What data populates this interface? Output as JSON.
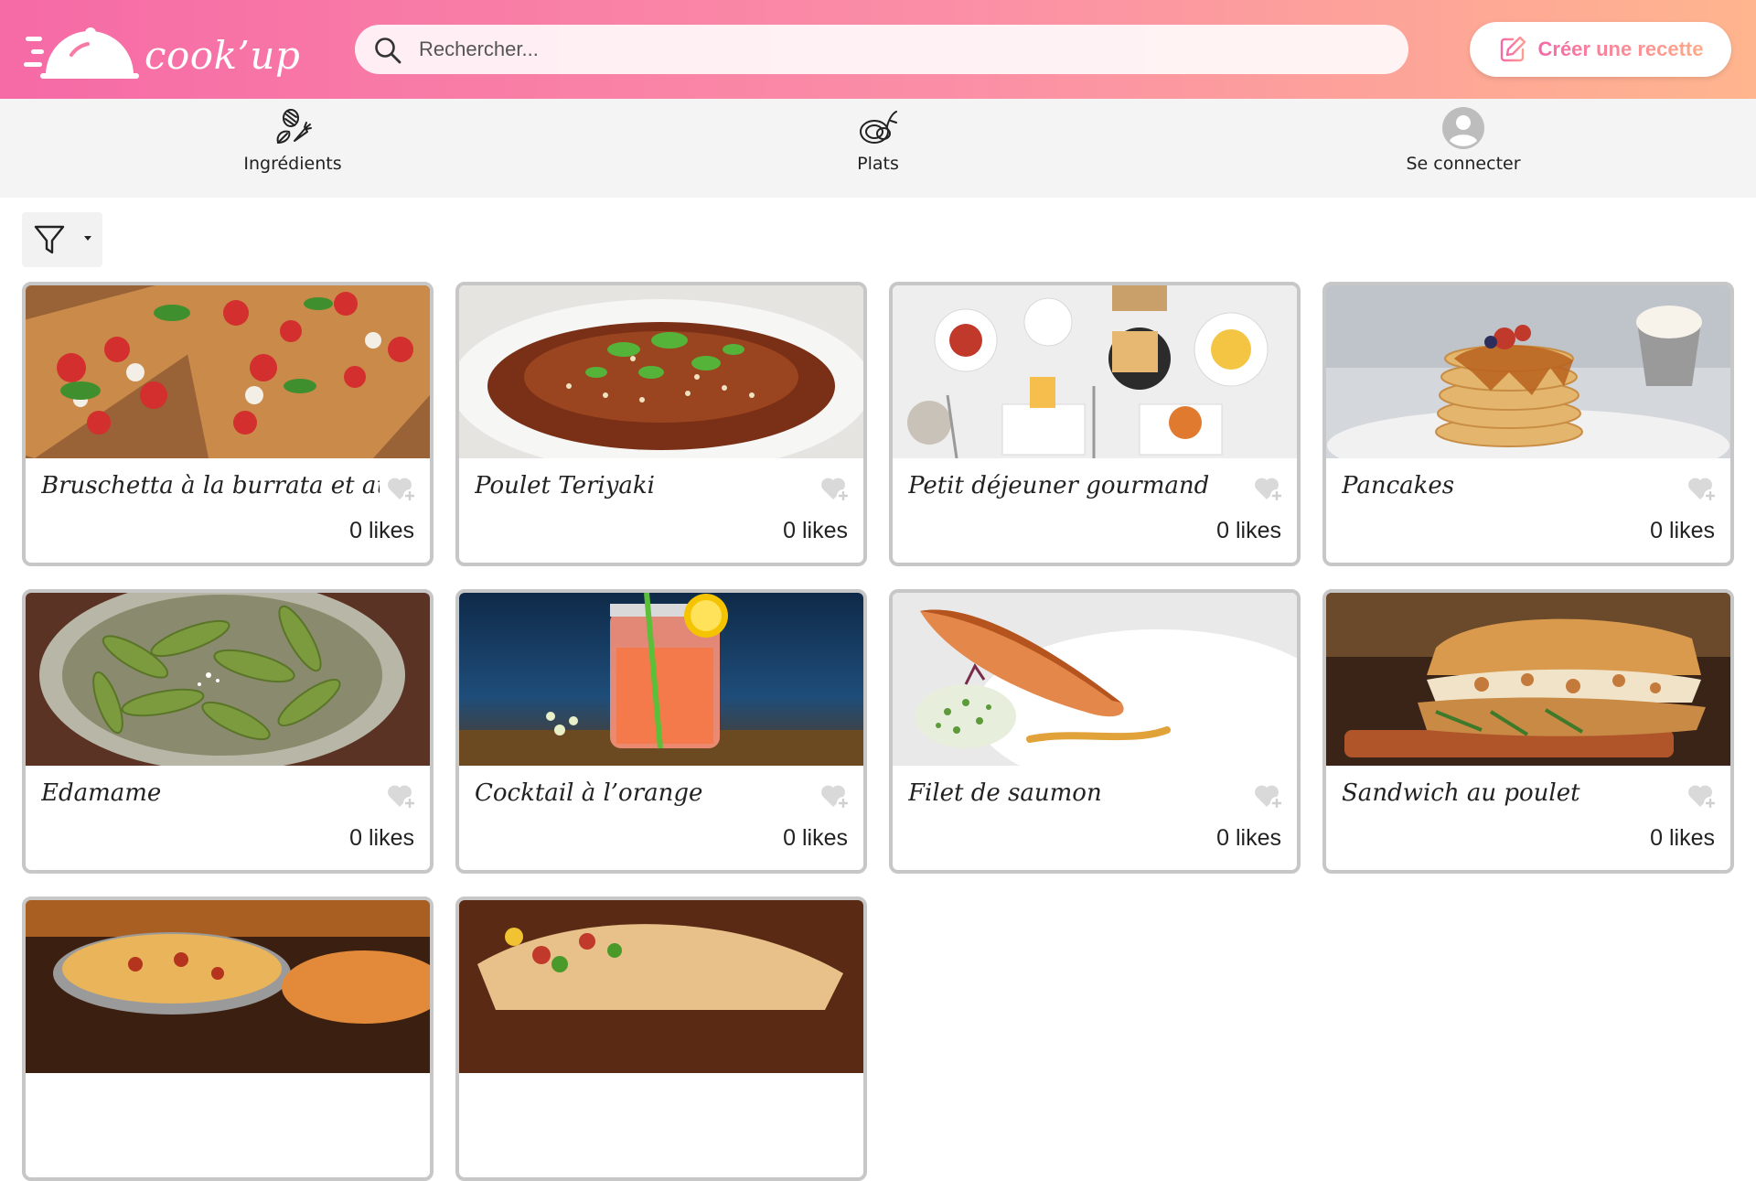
{
  "header": {
    "logo_text": "cook’up",
    "search_placeholder": "Rechercher...",
    "create_button_label": "Créer une recette"
  },
  "nav": {
    "items": [
      {
        "label": "Ingrédients",
        "icon": "ingredients-icon"
      },
      {
        "label": "Plats",
        "icon": "dish-icon"
      },
      {
        "label": "Se connecter",
        "icon": "user-avatar-icon"
      }
    ]
  },
  "filter": {
    "icon": "funnel-icon"
  },
  "colors": {
    "header_gradient_start": "#f66aa6",
    "header_gradient_end": "#ffb58e",
    "card_border": "#c7c7c7",
    "nav_background": "#f4f4f4"
  },
  "recipes": [
    {
      "title": "Bruschetta à la burrata et aux",
      "likes": "0 likes",
      "image": "bruschetta-photo"
    },
    {
      "title": "Poulet Teriyaki",
      "likes": "0 likes",
      "image": "teriyaki-photo"
    },
    {
      "title": "Petit déjeuner gourmand",
      "likes": "0 likes",
      "image": "breakfast-photo"
    },
    {
      "title": "Pancakes",
      "likes": "0 likes",
      "image": "pancakes-photo"
    },
    {
      "title": "Edamame",
      "likes": "0 likes",
      "image": "edamame-photo"
    },
    {
      "title": "Cocktail à l’orange",
      "likes": "0 likes",
      "image": "cocktail-photo"
    },
    {
      "title": "Filet de saumon",
      "likes": "0 likes",
      "image": "salmon-photo"
    },
    {
      "title": "Sandwich au poulet",
      "likes": "0 likes",
      "image": "sandwich-photo"
    },
    {
      "title": "",
      "likes": "",
      "image": "pizza-photo"
    },
    {
      "title": "",
      "likes": "",
      "image": "wrap-photo"
    }
  ]
}
